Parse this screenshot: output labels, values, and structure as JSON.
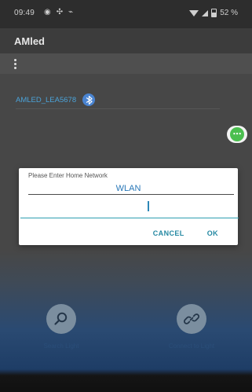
{
  "status_bar": {
    "time": "09:49",
    "battery": "52 %"
  },
  "app": {
    "title": "AMled"
  },
  "device": {
    "name": "AMLED_LEA5678"
  },
  "dialog": {
    "title": "Please Enter Home Network",
    "network_name": "WLAN",
    "input_value": "",
    "cancel_label": "CANCEL",
    "ok_label": "OK"
  },
  "actions": {
    "search_label": "Search Light",
    "connect_label": "Connect to Light"
  }
}
